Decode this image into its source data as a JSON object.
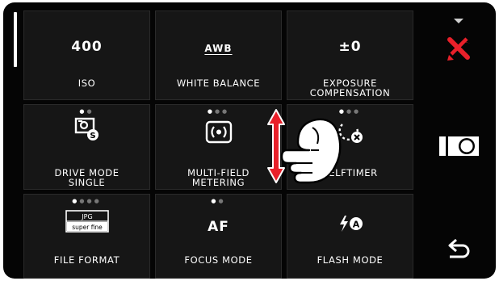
{
  "tiles": [
    {
      "value": "400",
      "label": "ISO"
    },
    {
      "value": "AWB",
      "label": "WHITE BALANCE"
    },
    {
      "value": "±0",
      "label": "EXPOSURE\nCOMPENSATION"
    },
    {
      "label": "DRIVE MODE\nSINGLE",
      "icon": "drive-single-icon",
      "page": 1,
      "pages": 2
    },
    {
      "label": "MULTI-FIELD\nMETERING",
      "icon": "metering-icon",
      "page": 1,
      "pages": 3
    },
    {
      "label": "SELFTIMER",
      "icon": "selftimer-off-icon",
      "page": 1,
      "pages": 3
    },
    {
      "label": "FILE FORMAT",
      "icon": "file-format-icon",
      "icon_text_top": "JPG",
      "icon_text_bottom": "super fine",
      "page": 1,
      "pages": 4
    },
    {
      "value": "AF",
      "label": "FOCUS MODE",
      "page": 1,
      "pages": 2
    },
    {
      "label": "FLASH MODE",
      "icon": "flash-auto-icon",
      "icon_text": "A"
    }
  ],
  "sidebar": {
    "items": [
      "scroll-down-arrow-icon",
      "settings-tools-icon",
      "camera-mode-icon",
      "back-arrow-icon"
    ]
  },
  "overlay": {
    "icon": "swipe-hand-icon",
    "arrow": "vertical-double-arrow-icon"
  },
  "colors": {
    "accent": "#e8202a",
    "tile_bg": "#161616",
    "screen_bg": "#050505",
    "text": "#ffffff"
  }
}
